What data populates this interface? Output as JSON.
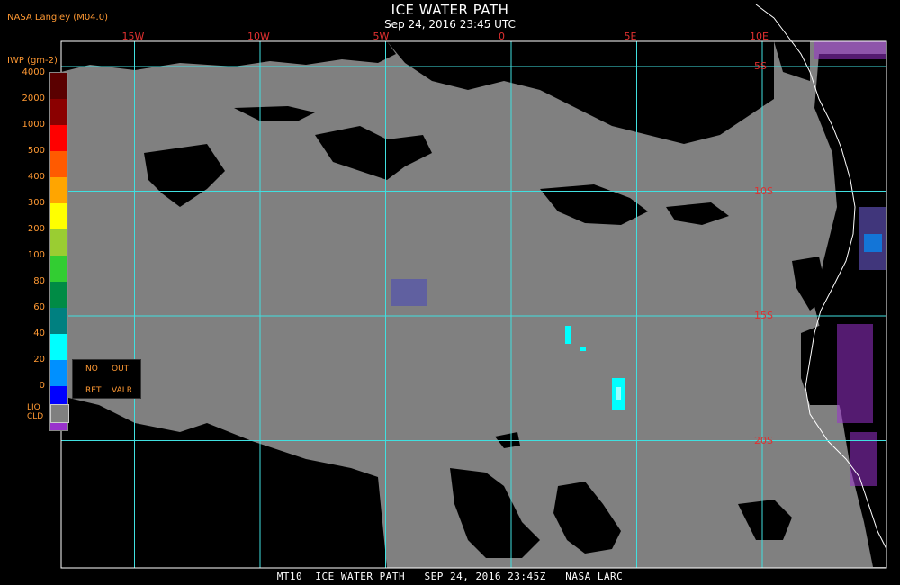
{
  "header": {
    "provider": "NASA Langley (M04.0)",
    "title": "ICE WATER PATH",
    "subtitle": "Sep 24, 2016 23:45 UTC"
  },
  "footer": {
    "text": "MT10  ICE WATER PATH   SEP 24, 2016 23:45Z   NASA LARC"
  },
  "map": {
    "longitudes": [
      {
        "label": "15W",
        "value": -15
      },
      {
        "label": "10W",
        "value": -10
      },
      {
        "label": "5W",
        "value": -5
      },
      {
        "label": "0",
        "value": 0
      },
      {
        "label": "5E",
        "value": 5
      },
      {
        "label": "10E",
        "value": 10
      }
    ],
    "latitudes": [
      {
        "label": "5S",
        "value": -5
      },
      {
        "label": "10S",
        "value": -10
      },
      {
        "label": "15S",
        "value": -15
      },
      {
        "label": "20S",
        "value": -20
      }
    ],
    "colors": {
      "grid": "#40e0e0",
      "grid_label": "#e03030",
      "cloud_free": "#000000",
      "liquid_cloud": "#808080",
      "coast": "#ffffff"
    }
  },
  "legend": {
    "title": "IWP (gm-2)",
    "ticks": [
      "4000",
      "2000",
      "1000",
      "500",
      "400",
      "300",
      "200",
      "100",
      "80",
      "60",
      "40",
      "20",
      "0"
    ],
    "colors": [
      "#5a0000",
      "#8b0000",
      "#ff0000",
      "#ff5a00",
      "#ffa500",
      "#ffff00",
      "#9acd32",
      "#32cd32",
      "#008b45",
      "#008080",
      "#00ffff",
      "#0090ff",
      "#0000ff",
      "#9932cc"
    ],
    "no_ret": "NO",
    "no_ret_2": "RET",
    "out_valr": "OUT",
    "out_valr_2": "VALR",
    "liq_cld_1": "LIQ",
    "liq_cld_2": "CLD"
  }
}
